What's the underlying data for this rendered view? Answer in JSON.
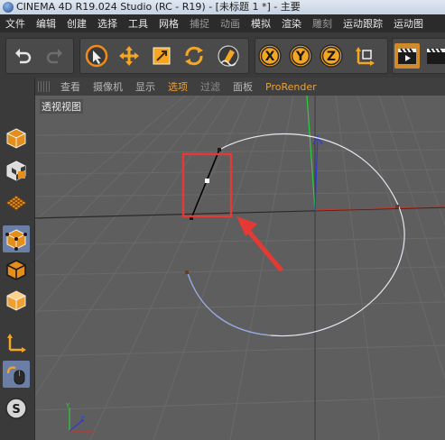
{
  "titlebar": {
    "title": "CINEMA 4D R19.024 Studio (RC - R19) - [未标题 1 *] - 主要"
  },
  "menu": {
    "items": [
      {
        "label": "文件",
        "style": ""
      },
      {
        "label": "编辑",
        "style": ""
      },
      {
        "label": "创建",
        "style": ""
      },
      {
        "label": "选择",
        "style": ""
      },
      {
        "label": "工具",
        "style": ""
      },
      {
        "label": "网格",
        "style": ""
      },
      {
        "label": "捕捉",
        "style": "dim"
      },
      {
        "label": "动画",
        "style": "dim"
      },
      {
        "label": "模拟",
        "style": ""
      },
      {
        "label": "渲染",
        "style": ""
      },
      {
        "label": "雕刻",
        "style": "dim"
      },
      {
        "label": "运动跟踪",
        "style": ""
      },
      {
        "label": "运动图",
        "style": ""
      }
    ]
  },
  "toolbar": {
    "undo_icon": "undo-icon",
    "redo_icon": "redo-icon",
    "axis_x": "X",
    "axis_y": "Y",
    "axis_z": "Z"
  },
  "viewport_menu": {
    "items": [
      {
        "label": "查看",
        "style": ""
      },
      {
        "label": "摄像机",
        "style": ""
      },
      {
        "label": "显示",
        "style": ""
      },
      {
        "label": "选项",
        "style": "hl"
      },
      {
        "label": "过滤",
        "style": "dim"
      },
      {
        "label": "面板",
        "style": ""
      },
      {
        "label": "ProRender",
        "style": "hl"
      }
    ]
  },
  "viewport": {
    "label": "透视视图",
    "axis_colors": {
      "x": "#c0392b",
      "y": "#2ecc40",
      "z": "#2b3bd6"
    },
    "spline_color": "#e8e8f4",
    "highlight_color": "#e53935"
  },
  "sidebar": {
    "icons": [
      "cube-icon",
      "checker-cube-icon",
      "grid-plane-icon",
      "points-mode-icon",
      "edges-mode-icon",
      "polygons-mode-icon",
      "axis-mode-icon",
      "mouse-tweak-icon",
      "snap-icon"
    ]
  }
}
